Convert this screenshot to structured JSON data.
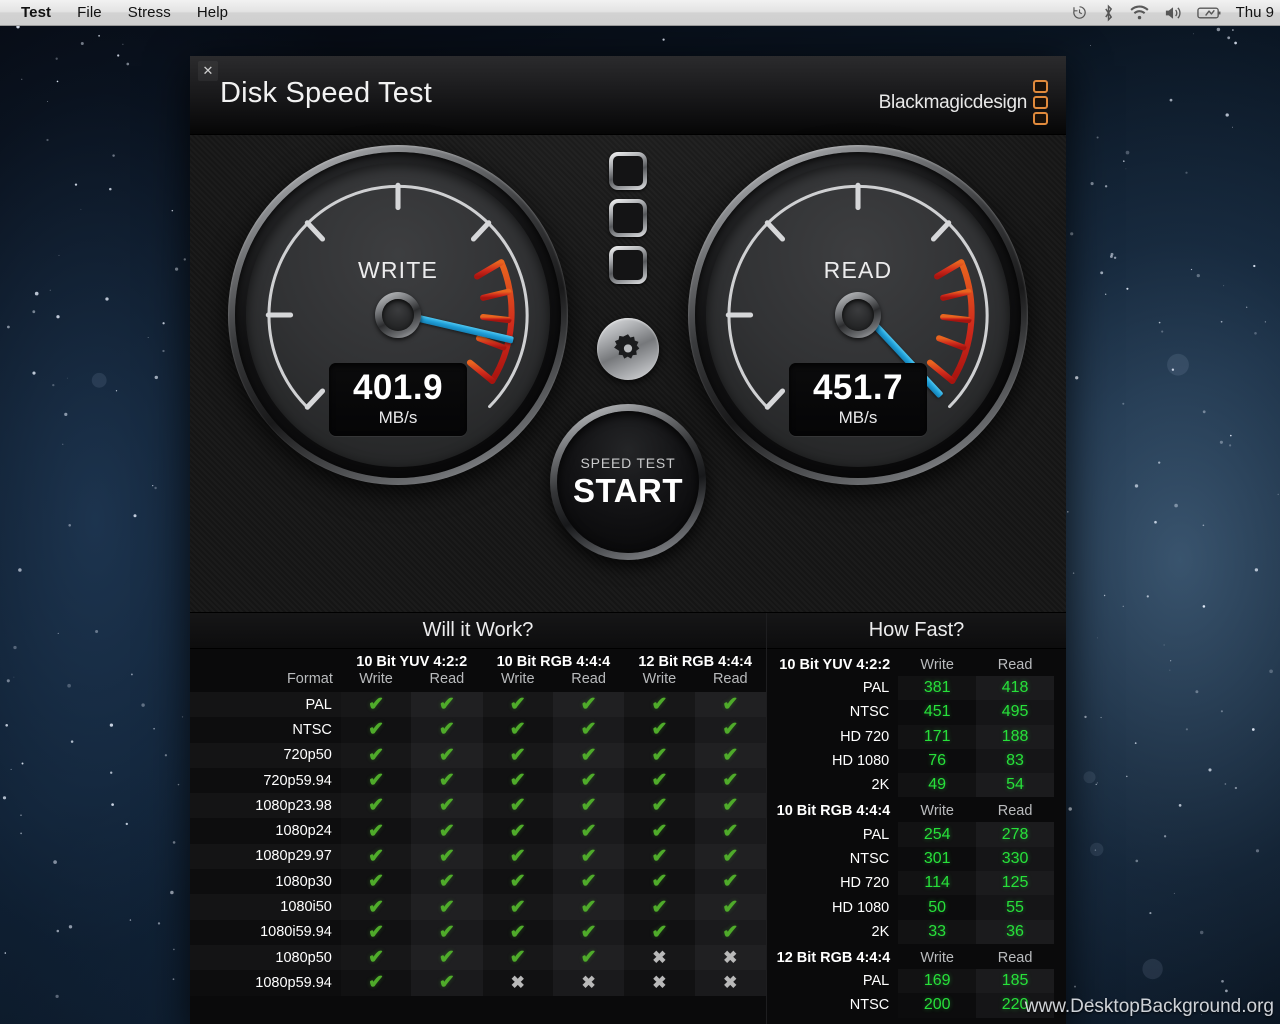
{
  "menubar": {
    "items": [
      {
        "label": "Test",
        "bold": true
      },
      {
        "label": "File",
        "bold": false
      },
      {
        "label": "Stress",
        "bold": false
      },
      {
        "label": "Help",
        "bold": false
      }
    ],
    "status_icons": [
      "time-machine-icon",
      "bluetooth-icon",
      "wifi-icon",
      "volume-icon",
      "battery-icon"
    ],
    "clock": "Thu 9"
  },
  "window": {
    "close_label": "✕",
    "title": "Disk Speed Test",
    "brand": "Blackmagicdesign"
  },
  "gauges": {
    "write": {
      "label": "WRITE",
      "value": "401.9",
      "unit": "MB/s",
      "needle_angle": 13
    },
    "read": {
      "label": "READ",
      "value": "451.7",
      "unit": "MB/s",
      "needle_angle": 47
    }
  },
  "center": {
    "led_count": 3,
    "gear_label": "gear-icon",
    "start_sub": "SPEED TEST",
    "start_main": "START"
  },
  "will_it_work": {
    "header": "Will it Work?",
    "format_label": "Format",
    "groups": [
      "10 Bit YUV 4:2:2",
      "10 Bit RGB 4:4:4",
      "12 Bit RGB 4:4:4"
    ],
    "sub_headers": [
      "Write",
      "Read",
      "Write",
      "Read",
      "Write",
      "Read"
    ],
    "ok_glyph": "✔",
    "no_glyph": "✖",
    "rows": [
      {
        "format": "PAL",
        "cells": [
          true,
          true,
          true,
          true,
          true,
          true
        ]
      },
      {
        "format": "NTSC",
        "cells": [
          true,
          true,
          true,
          true,
          true,
          true
        ]
      },
      {
        "format": "720p50",
        "cells": [
          true,
          true,
          true,
          true,
          true,
          true
        ]
      },
      {
        "format": "720p59.94",
        "cells": [
          true,
          true,
          true,
          true,
          true,
          true
        ]
      },
      {
        "format": "1080p23.98",
        "cells": [
          true,
          true,
          true,
          true,
          true,
          true
        ]
      },
      {
        "format": "1080p24",
        "cells": [
          true,
          true,
          true,
          true,
          true,
          true
        ]
      },
      {
        "format": "1080p29.97",
        "cells": [
          true,
          true,
          true,
          true,
          true,
          true
        ]
      },
      {
        "format": "1080p30",
        "cells": [
          true,
          true,
          true,
          true,
          true,
          true
        ]
      },
      {
        "format": "1080i50",
        "cells": [
          true,
          true,
          true,
          true,
          true,
          true
        ]
      },
      {
        "format": "1080i59.94",
        "cells": [
          true,
          true,
          true,
          true,
          true,
          true
        ]
      },
      {
        "format": "1080p50",
        "cells": [
          true,
          true,
          true,
          true,
          false,
          false
        ]
      },
      {
        "format": "1080p59.94",
        "cells": [
          true,
          true,
          false,
          false,
          false,
          false
        ]
      }
    ]
  },
  "how_fast": {
    "header": "How Fast?",
    "col_write": "Write",
    "col_read": "Read",
    "sections": [
      {
        "title": "10 Bit YUV 4:2:2",
        "rows": [
          {
            "label": "PAL",
            "write": "381",
            "read": "418"
          },
          {
            "label": "NTSC",
            "write": "451",
            "read": "495"
          },
          {
            "label": "HD 720",
            "write": "171",
            "read": "188"
          },
          {
            "label": "HD 1080",
            "write": "76",
            "read": "83"
          },
          {
            "label": "2K",
            "write": "49",
            "read": "54"
          }
        ]
      },
      {
        "title": "10 Bit RGB 4:4:4",
        "rows": [
          {
            "label": "PAL",
            "write": "254",
            "read": "278"
          },
          {
            "label": "NTSC",
            "write": "301",
            "read": "330"
          },
          {
            "label": "HD 720",
            "write": "114",
            "read": "125"
          },
          {
            "label": "HD 1080",
            "write": "50",
            "read": "55"
          },
          {
            "label": "2K",
            "write": "33",
            "read": "36"
          }
        ]
      },
      {
        "title": "12 Bit RGB 4:4:4",
        "rows": [
          {
            "label": "PAL",
            "write": "169",
            "read": "185"
          },
          {
            "label": "NTSC",
            "write": "200",
            "read": "220"
          }
        ]
      }
    ]
  },
  "watermark": "www.DesktopBackground.org",
  "colors": {
    "accent_green": "#27e03a",
    "needle_blue": "#1f9fd8",
    "brand_orange": "#e08a3c",
    "check_green": "#4fab2a"
  }
}
